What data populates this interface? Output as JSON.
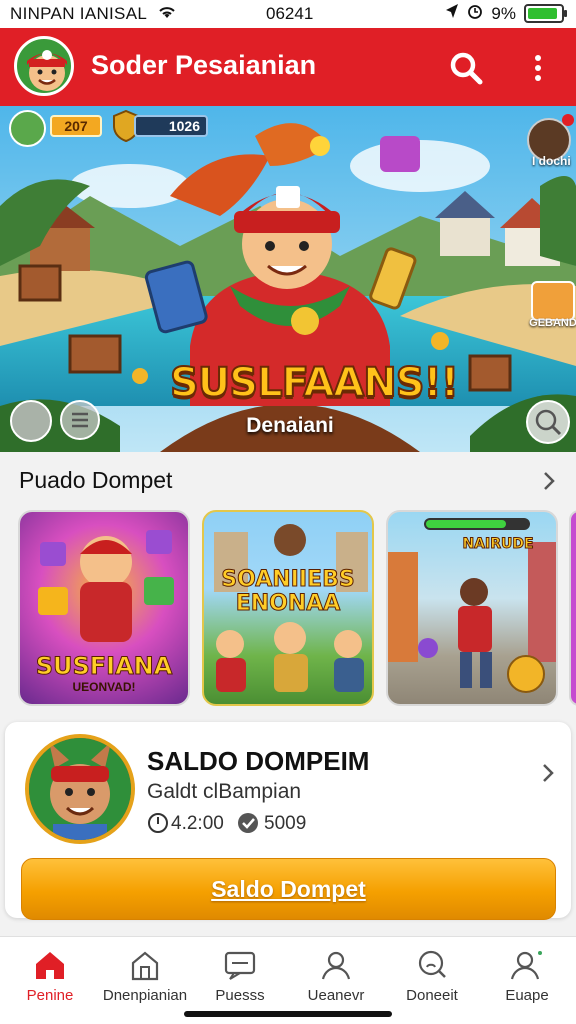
{
  "status_bar": {
    "carrier": "NINPAN IANISAL",
    "time": "06241",
    "battery": "9%",
    "battery_level": 0.9
  },
  "app_bar": {
    "title": "Soder Pesaianian",
    "search_icon": "search-icon",
    "more_icon": "more-vertical-icon"
  },
  "hero": {
    "coins": "207",
    "gems": "1026",
    "profile_label": "I dochi",
    "chest_label": "GEBAND",
    "logo_text": "SUSLFAANS!!",
    "subtitle": "Denaiani"
  },
  "section": {
    "title": "Puado Dompet"
  },
  "cards": [
    {
      "label": "SUSFIANA",
      "sublabel": "UEONVAD!"
    },
    {
      "label": "SOANIIEBS ENONAA"
    },
    {
      "label": "NAIRUDE"
    }
  ],
  "wallet": {
    "title": "SALDO DOMPEIM",
    "subtitle": "Galdt clBampian",
    "stat1": "4.2:00",
    "stat2": "5009",
    "button_label": "Saldo Dompet"
  },
  "nav": {
    "items": [
      {
        "label": "Penine",
        "icon": "home-icon"
      },
      {
        "label": "Dnenpianian",
        "icon": "store-icon"
      },
      {
        "label": "Puesss",
        "icon": "chat-icon"
      },
      {
        "label": "Ueanevr",
        "icon": "user-icon"
      },
      {
        "label": "Doneeit",
        "icon": "search-user-icon"
      },
      {
        "label": "Euape",
        "icon": "profile-settings-icon"
      }
    ]
  },
  "colors": {
    "brand_red": "#e01f26",
    "accent_orange": "#f5a000"
  }
}
